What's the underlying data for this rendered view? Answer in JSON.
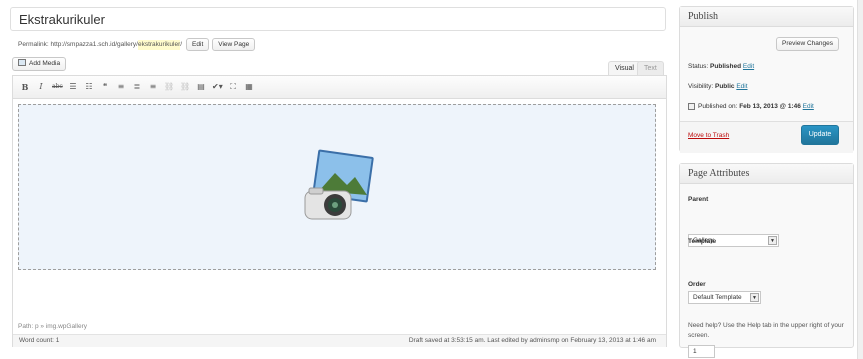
{
  "post": {
    "title": "Ekstrakurikuler",
    "permalink_label": "Permalink:",
    "permalink_base": "http://smpazza1.sch.id/gallery/",
    "permalink_slug": "ekstrakurikuler",
    "permalink_tail": "/",
    "edit_button": "Edit",
    "view_page_button": "View Page"
  },
  "editor": {
    "add_media": "Add Media",
    "tab_visual": "Visual",
    "tab_text": "Text",
    "path": "Path: p » img.wpGallery",
    "word_count": "Word count: 1",
    "draft_status": "Draft saved at 3:53:15 am. Last edited by adminsmp on February 13, 2013 at 1:46 am"
  },
  "publish": {
    "title": "Publish",
    "preview_button": "Preview Changes",
    "status_label": "Status:",
    "status_value": "Published",
    "visibility_label": "Visibility:",
    "visibility_value": "Public",
    "edit_link": "Edit",
    "published_label": "Published on:",
    "published_value": "Feb 13, 2013 @ 1:46",
    "move_to_trash": "Move to Trash",
    "update_button": "Update"
  },
  "page_attributes": {
    "title": "Page Attributes",
    "parent_label": "Parent",
    "parent_value": "Gallery",
    "template_label": "Template",
    "template_value": "Default Template",
    "order_label": "Order",
    "order_value": "1",
    "help_text": "Need help? Use the Help tab in the upper right of your screen."
  },
  "colors": {
    "accent": "#21759b",
    "trash": "#bc0b0b",
    "slug_highlight": "#fffbcc"
  }
}
